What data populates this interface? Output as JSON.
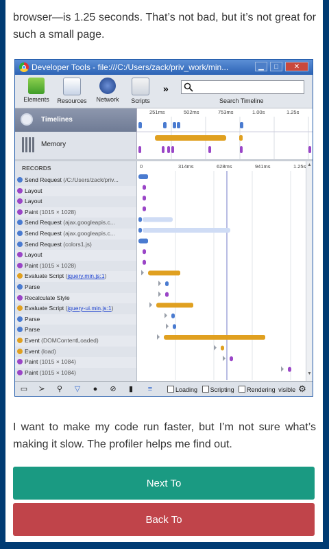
{
  "article": {
    "para1": "browser—is 1.25 seconds. That’s not bad, but it’s not great for such a small page.",
    "para2": "I want to make my code run faster, but I’m not sure what’s making it slow. The profiler helps me find out."
  },
  "buttons": {
    "next": "Next To",
    "back": "Back To"
  },
  "devtools": {
    "title": "Developer Tools - file:///C:/Users/zack/priv_work/min...",
    "window_buttons": [
      "▁",
      "□",
      "✕"
    ],
    "tools": [
      "Elements",
      "Resources",
      "Network",
      "Scripts"
    ],
    "more": "»",
    "search_label": "Search Timeline",
    "overview": {
      "ruler": [
        "251ms",
        "502ms",
        "753ms",
        "1.00s",
        "1.25s"
      ],
      "timelines": "Timelines",
      "memory": "Memory"
    },
    "records_header": "RECORDS",
    "records_ruler": [
      "0",
      "314ms",
      "628ms",
      "941ms",
      "1.25s"
    ],
    "records": [
      {
        "label": "Send Request",
        "detail": " (/C:/Users/zack/priv...",
        "color": "#4a7bd0"
      },
      {
        "label": "Layout",
        "detail": "",
        "color": "#9a45c7"
      },
      {
        "label": "Layout",
        "detail": "",
        "color": "#9a45c7"
      },
      {
        "label": "Paint",
        "detail": " (1015 × 1028)",
        "color": "#9a45c7"
      },
      {
        "label": "Send Request",
        "detail": " (ajax.googleapis.c...",
        "color": "#4a7bd0"
      },
      {
        "label": "Send Request",
        "detail": " (ajax.googleapis.c...",
        "color": "#4a7bd0"
      },
      {
        "label": "Send Request",
        "detail": " (colors1.js)",
        "color": "#4a7bd0"
      },
      {
        "label": "Layout",
        "detail": "",
        "color": "#9a45c7"
      },
      {
        "label": "Paint",
        "detail": " (1015 × 1028)",
        "color": "#9a45c7"
      },
      {
        "label": "Evaluate Script",
        "detail": " (",
        "link": "jquery.min.js:1",
        "tail": ")",
        "color": "#e0a020"
      },
      {
        "label": "Parse",
        "detail": "",
        "color": "#4a7bd0"
      },
      {
        "label": "Recalculate Style",
        "detail": "",
        "color": "#9a45c7"
      },
      {
        "label": "Evaluate Script",
        "detail": " (",
        "link": "jquery-ui.min.js:1",
        "tail": ")",
        "color": "#e0a020"
      },
      {
        "label": "Parse",
        "detail": "",
        "color": "#4a7bd0"
      },
      {
        "label": "Parse",
        "detail": "",
        "color": "#4a7bd0"
      },
      {
        "label": "Event",
        "detail": " (DOMContentLoaded)",
        "color": "#e0a020"
      },
      {
        "label": "Event",
        "detail": " (load)",
        "color": "#e0a020"
      },
      {
        "label": "Paint",
        "detail": " (1015 × 1084)",
        "color": "#9a45c7"
      },
      {
        "label": "Paint",
        "detail": " (1015 × 1084)",
        "color": "#9a45c7"
      }
    ],
    "status": {
      "loading": "Loading",
      "scripting": "Scripting",
      "rendering": "Rendering",
      "visible": "visible"
    },
    "colors": {
      "loading": "#4a7bd0",
      "scripting": "#e0a020",
      "rendering": "#9a45c7"
    }
  }
}
